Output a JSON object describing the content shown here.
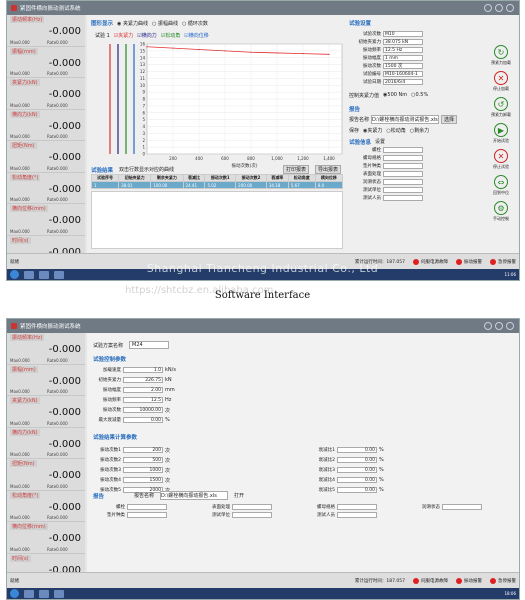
{
  "screen1": {
    "title": "紧固件横向振动测试系统",
    "gauges": [
      {
        "label": "振动频率(Hz)",
        "value": "-0.000",
        "max": "Max0.000",
        "rate": "Rate0.000"
      },
      {
        "label": "振幅(mm)",
        "value": "-0.000",
        "max": "Max0.000",
        "rate": "Rate0.000"
      },
      {
        "label": "夹紧力(kN)",
        "value": "-0.000",
        "max": "Max0.000",
        "rate": "Rate0.000"
      },
      {
        "label": "横向力(kN)",
        "value": "-0.000",
        "max": "Max0.000",
        "rate": "Rate0.000"
      },
      {
        "label": "扭矩(Nm)",
        "value": "-0.000",
        "max": "Max0.000",
        "rate": "Rate0.000"
      },
      {
        "label": "松动角度(°)",
        "value": "-0.000",
        "max": "Max0.000",
        "rate": "Rate0.000"
      },
      {
        "label": "横向位移(mm)",
        "value": "-0.000",
        "max": "Max0.000",
        "rate": "Rate0.000"
      },
      {
        "label": "时间(s)",
        "value": "-0.000",
        "max": "",
        "rate": ""
      }
    ],
    "chart_options": {
      "label": "图形显示",
      "opt1": "夹紧力曲线",
      "opt2": "振幅曲线",
      "opt3": "循环次数"
    },
    "curve_legend": {
      "test_label": "试验 1",
      "s1": "夹紧力",
      "s2": "横向力",
      "s3": "松动角",
      "s4": "横向位移"
    },
    "chart_data": {
      "type": "line",
      "xlabel": "振动次数(次)",
      "x_ticks": [
        "200",
        "400",
        "600",
        "800",
        "1,000",
        "1,200",
        "1,400"
      ],
      "y_ticks": [
        "0",
        "1",
        "2",
        "3",
        "4",
        "5",
        "6",
        "7",
        "8",
        "9",
        "10",
        "11",
        "12",
        "13",
        "14",
        "15",
        "16"
      ],
      "series": [
        {
          "name": "夹紧力",
          "x": [
            0,
            200,
            400,
            600,
            800,
            1000,
            1200,
            1400
          ],
          "y": [
            15.6,
            15.4,
            15.2,
            15.0,
            14.8,
            14.7,
            14.6,
            14.5
          ]
        }
      ]
    },
    "results": {
      "heading": "试验结果",
      "hint": "双击行数显示对应的曲线",
      "btn_print": "打印报表",
      "btn_export": "导出报表",
      "columns": [
        "试验序号",
        "初始夹紧力",
        "剩余夹紧力",
        "衰减比",
        "振动次数1",
        "振动次数2",
        "衰减率",
        "松动角度",
        "横向位移"
      ],
      "rows": [
        [
          "1",
          "38.01",
          "100.00",
          "24.41",
          "5.02",
          "200.00",
          "34.18",
          "5.67",
          "8.0"
        ]
      ]
    },
    "settings": {
      "heading": "试验设置",
      "fields": [
        {
          "label": "试验次数",
          "value": "M10"
        },
        {
          "label": "初始夹紧力",
          "value": "38.075 kN"
        },
        {
          "label": "振动频率",
          "value": "12.5 Hz"
        },
        {
          "label": "振动幅度",
          "value": "1 mm"
        },
        {
          "label": "振动次数",
          "value": "1500 次"
        },
        {
          "label": "试验编号",
          "value": "M10-160604-1"
        },
        {
          "label": "试验日期",
          "value": "2016/6/4"
        }
      ],
      "mode_label": "控制夹紧力值",
      "mode_a": "500 Nm",
      "mode_b": "0.5%",
      "report_heading": "报告",
      "report_name_label": "报告名称",
      "report_name": "D:\\螺栓横向振动测试报告.xls",
      "browse": "选择",
      "save_label": "保存",
      "opt_a": "夹紧力",
      "opt_b": "松动角",
      "opt_c": "剩余力",
      "info_heading": "试验信息",
      "info_set": "设置",
      "info_fields": [
        "螺栓",
        "螺母规格",
        "垫片种类",
        "表面处理",
        "润滑状态",
        "测试单位",
        "测试人员"
      ]
    },
    "right_buttons": [
      "预紧力加载",
      "停止加载",
      "预紧力卸载",
      "开始试验",
      "停止试验",
      "回到中位",
      "手动控制"
    ],
    "status": {
      "left": "就绪",
      "time": "累计运行时间：187.057",
      "alarm1": "伺服电源故障",
      "alarm2": "振动报警",
      "alarm3": "急停报警"
    },
    "clock": "11:06"
  },
  "caption": "Software Interface",
  "watermark": "Shanghai Tiancheng Industrial Co., Ltd",
  "watermark_url": "https://shtcbz.en.alibaba.com",
  "screen2": {
    "title": "紧固件横向振动测试系统",
    "gauges": [
      {
        "label": "振动频率(Hz)",
        "value": "-0.000",
        "max": "Max0.000",
        "rate": "Rate0.000"
      },
      {
        "label": "振幅(mm)",
        "value": "-0.000",
        "max": "Max0.000",
        "rate": "Rate0.000"
      },
      {
        "label": "夹紧力(kN)",
        "value": "-0.000",
        "max": "Max0.000",
        "rate": "Rate0.000"
      },
      {
        "label": "横向力(kN)",
        "value": "-0.000",
        "max": "Max0.000",
        "rate": "Rate0.000"
      },
      {
        "label": "扭矩(Nm)",
        "value": "-0.000",
        "max": "Max0.000",
        "rate": "Rate0.000"
      },
      {
        "label": "松动角度(°)",
        "value": "-0.000",
        "max": "Max0.000",
        "rate": "Rate0.000"
      },
      {
        "label": "横向位移(mm)",
        "value": "-0.000",
        "max": "Max0.000",
        "rate": "Rate0.000"
      },
      {
        "label": "时间(s)",
        "value": "-0.000",
        "max": "",
        "rate": ""
      }
    ],
    "plan_label": "试验方案名称",
    "plan_value": "M24",
    "control_heading": "试验控制参数",
    "control_fields": [
      {
        "label": "加载速度",
        "value": "1.0",
        "unit": "kN/s"
      },
      {
        "label": "初始夹紧力",
        "value": "226.75",
        "unit": "kN"
      },
      {
        "label": "振动幅度",
        "value": "2.00",
        "unit": "mm"
      },
      {
        "label": "振动频率",
        "value": "12.5",
        "unit": "Hz"
      },
      {
        "label": "振动次数",
        "value": "10000.00",
        "unit": "次"
      },
      {
        "label": "最大衰减量",
        "value": "0.00",
        "unit": "%"
      }
    ],
    "calc_heading": "试验结果计算参数",
    "calc_left": [
      {
        "label": "振动次数1",
        "value": "200",
        "unit": "次"
      },
      {
        "label": "振动次数2",
        "value": "500",
        "unit": "次"
      },
      {
        "label": "振动次数3",
        "value": "1000",
        "unit": "次"
      },
      {
        "label": "振动次数4",
        "value": "1500",
        "unit": "次"
      },
      {
        "label": "振动次数5",
        "value": "2000",
        "unit": "次"
      }
    ],
    "calc_right": [
      {
        "label": "衰减比1",
        "value": "0.00",
        "unit": "%"
      },
      {
        "label": "衰减比2",
        "value": "0.00",
        "unit": "%"
      },
      {
        "label": "衰减比3",
        "value": "0.00",
        "unit": "%"
      },
      {
        "label": "衰减比4",
        "value": "0.00",
        "unit": "%"
      },
      {
        "label": "衰减比5",
        "value": "0.00",
        "unit": "%"
      }
    ],
    "report_heading": "报告",
    "report_name_label": "报告名称",
    "report_name": "D:\\螺栓横向振动报告.xls",
    "open_btn": "打开",
    "info_fields": [
      "螺栓",
      "表面处理",
      "螺母规格",
      "润滑状态",
      "垫片种类",
      "测试单位",
      "测试人员"
    ],
    "status": {
      "left": "就绪",
      "time": "累计运行时间：187.057",
      "alarm1": "伺服电源故障",
      "alarm2": "振动报警",
      "alarm3": "急停报警"
    },
    "clock": "18:06"
  }
}
